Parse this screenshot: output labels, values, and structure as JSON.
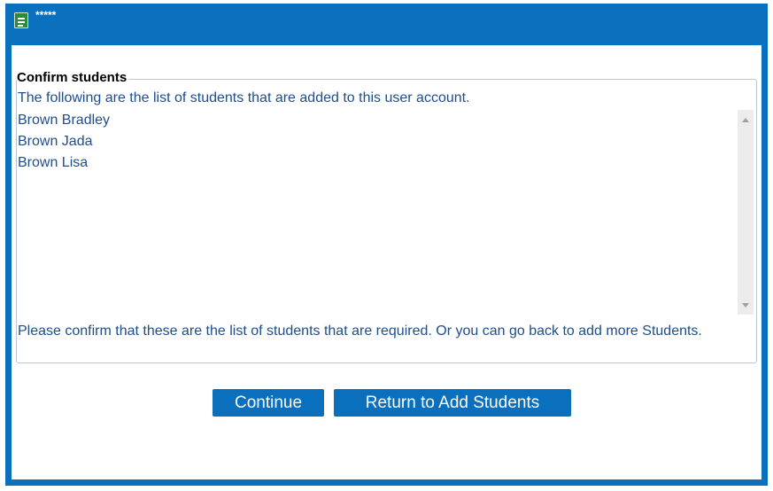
{
  "window": {
    "title": "*****",
    "icon": "document-icon",
    "frame_color": "#0a6fbd"
  },
  "section": {
    "legend": "Confirm students",
    "intro": "The following are the list of students that are added to this user account.",
    "students": [
      "Brown Bradley",
      "Brown Jada",
      "Brown Lisa"
    ],
    "confirm_text": "Please confirm that these are the list of students that are required. Or you can go back to add more Students."
  },
  "buttons": {
    "continue_label": "Continue",
    "return_label": "Return to Add Students"
  },
  "colors": {
    "accent": "#0a6fbd",
    "text": "#1f4e8c"
  }
}
